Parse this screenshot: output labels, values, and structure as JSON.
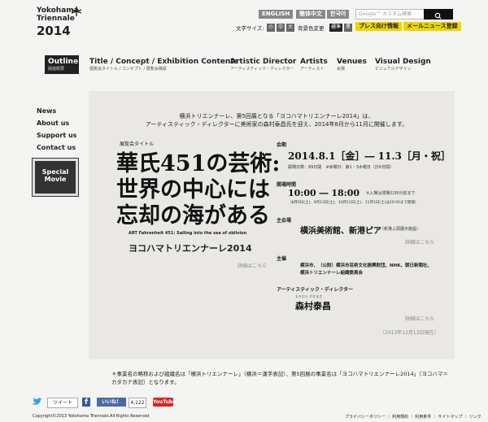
{
  "header": {
    "logo_line1": "Yokohama",
    "logo_line2": "Triennale",
    "logo_year": "2014",
    "lang_buttons": [
      "ENGLISH",
      "簡体中文",
      "한국어"
    ],
    "search_placeholder": "Google™ カスタム検索",
    "font_size_label": "文字サイズ:",
    "font_sizes": [
      "小",
      "中",
      "大"
    ],
    "bg_color_label": "背景色変更",
    "bg_options": [
      "標準",
      "黒"
    ],
    "press_button": "プレス向け情報",
    "newsletter_button": "メールニュース登録"
  },
  "nav": {
    "items": [
      {
        "label": "Outline",
        "sub": "開催概要"
      },
      {
        "label": "Title / Concept / Exhibition Contents",
        "sub": "展覧会タイトル / コンセプト / 展覧会構成"
      },
      {
        "label": "Artistic Director",
        "sub": "アーティスティック・ディレクター"
      },
      {
        "label": "Artists",
        "sub": "アーティスト"
      },
      {
        "label": "Venues",
        "sub": "会場"
      },
      {
        "label": "Visual Design",
        "sub": "ビジュアルデザイン"
      }
    ]
  },
  "sidebar": {
    "items": [
      "News",
      "About us",
      "Support us",
      "Contact us"
    ],
    "special_line1": "Special",
    "special_line2": "Movie"
  },
  "main": {
    "intro_line1": "横浜トリエンナーレ、第5回展となる「ヨコハマトリエンナーレ2014」は、",
    "intro_line2": "アーティスティック・ディレクターに美術家の森村泰昌氏を迎え、2014年8月から11月に開催します。",
    "title_label": "展覧会タイトル",
    "title_line1": "華氏451の芸術:",
    "title_line2": "世界の中心には",
    "title_line3": "忘却の海がある",
    "title_en": "ART Fahrenheit 451: Sailing into the sea of oblivion",
    "event_name": "ヨコハマトリエンナーレ2014",
    "details_link": "詳細はこちら",
    "period_label": "会期",
    "period_value": "2014.8.1［金］― 11.3［月・祝］",
    "period_note": "開場日数：89日間　※休場日：第1・3木曜日（計6日間）",
    "hours_label": "開場時間",
    "hours_value": "10:00 ― 18:00",
    "hours_note1": "※入場は閉場の30分前まで",
    "hours_note2": "（8月9日(土)、9月13日(土)、10月11日(土)、11月1日(土)は20:00まで開場）",
    "venue_label": "主会場",
    "venue_value": "横浜美術館、新港ピア",
    "venue_note": "（新港ふ頭展示施設）",
    "venue_details": "詳細はこちら",
    "organizer_label": "主催",
    "organizer_value1": "横浜市、（公財）横浜市芸術文化振興財団、NHK、朝日新聞社、",
    "organizer_value2": "横浜トリエンナーレ組織委員会",
    "director_label": "アーティスティック・ディレクター",
    "director_ruby": "もりむら やすまさ",
    "director_name": "森村泰昌",
    "director_details": "詳細はこちら",
    "updated": "（2013年12月13日現在）"
  },
  "note": {
    "line1": "＊事業名の略称および組織名は「横浜トリエンナーレ」（横浜＝漢字表記）、第5回展の事業名は「ヨコハマトリエンナーレ2014」（ヨコハマ＝",
    "line2": "カタカナ表記）となります。"
  },
  "social": {
    "tweet": "ツイート",
    "like": "いいね！",
    "like_count": "4,122",
    "youtube": "YouTube"
  },
  "footer": {
    "copyright": "Copyright©2013 Yokohama Triennale.All Rights Reserved",
    "links": "プライバシーポリシー ｜ 利用規約 ｜ 利用条件 ｜ サイトマップ ｜ リンク"
  },
  "colors": {
    "accent_yellow": "#f0d400",
    "dark": "#222222",
    "panel_bg": "#e9e8e5",
    "page_bg": "#f4f4f2"
  }
}
